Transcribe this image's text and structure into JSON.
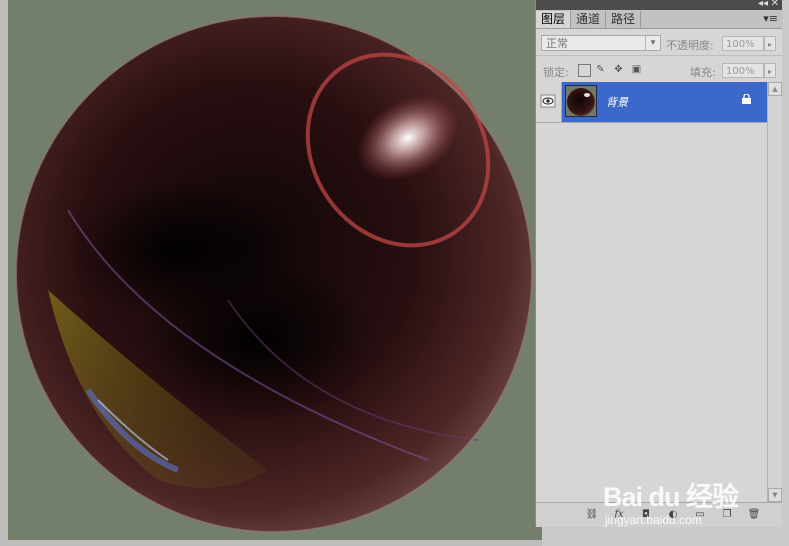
{
  "colors": {
    "canvas_bg": "#737e6b",
    "selected_layer": "#3c68c9",
    "panel_bg": "#d6d6d6"
  },
  "panel": {
    "tabs": [
      {
        "label": "图层",
        "active": true
      },
      {
        "label": "通道",
        "active": false
      },
      {
        "label": "路径",
        "active": false
      }
    ],
    "blend_mode": "正常",
    "opacity_label": "不透明度:",
    "opacity_value": "100%",
    "lock_label": "锁定:",
    "fill_label": "填充:",
    "fill_value": "100%",
    "layers": [
      {
        "name": "背景",
        "visible": true,
        "locked": true,
        "selected": true
      }
    ]
  },
  "icons": {
    "collapse": "double-chevron-left-icon",
    "close": "close-icon",
    "panel_menu": "panel-menu-icon",
    "eye": "eye-icon",
    "lock": "lock-icon",
    "bottom": [
      "link-icon",
      "fx-icon",
      "mask-icon",
      "adjustment-icon",
      "group-folder-icon",
      "new-layer-icon",
      "trash-icon"
    ]
  },
  "watermark": {
    "logo_text": "Bai du 经验",
    "url": "jingyan.baidu.com"
  }
}
